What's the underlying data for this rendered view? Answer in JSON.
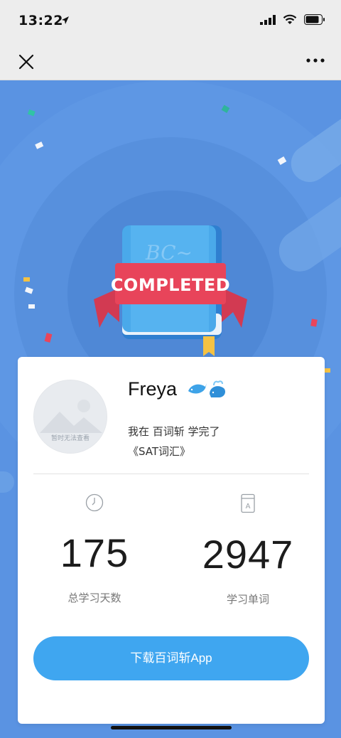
{
  "status_bar": {
    "time": "13:22"
  },
  "hero": {
    "badge_text": "COMPLETED",
    "book_cover_text": "BC~"
  },
  "profile": {
    "avatar_caption": "暂时无法查看",
    "user_name": "Freya",
    "learned_prefix": "我在 百词斩 学完了",
    "book_title": "《SAT词汇》"
  },
  "stats": [
    {
      "value": "175",
      "label": "总学习天数",
      "icon": "clock-icon"
    },
    {
      "value": "2947",
      "label": "学习单词",
      "icon": "book-a-icon"
    }
  ],
  "download_button": {
    "label": "下载百词斩App"
  },
  "colors": {
    "background": "#5a93e2",
    "button": "#3fa6f0",
    "ribbon": "#e8445a",
    "book": "#4aa9ea"
  }
}
